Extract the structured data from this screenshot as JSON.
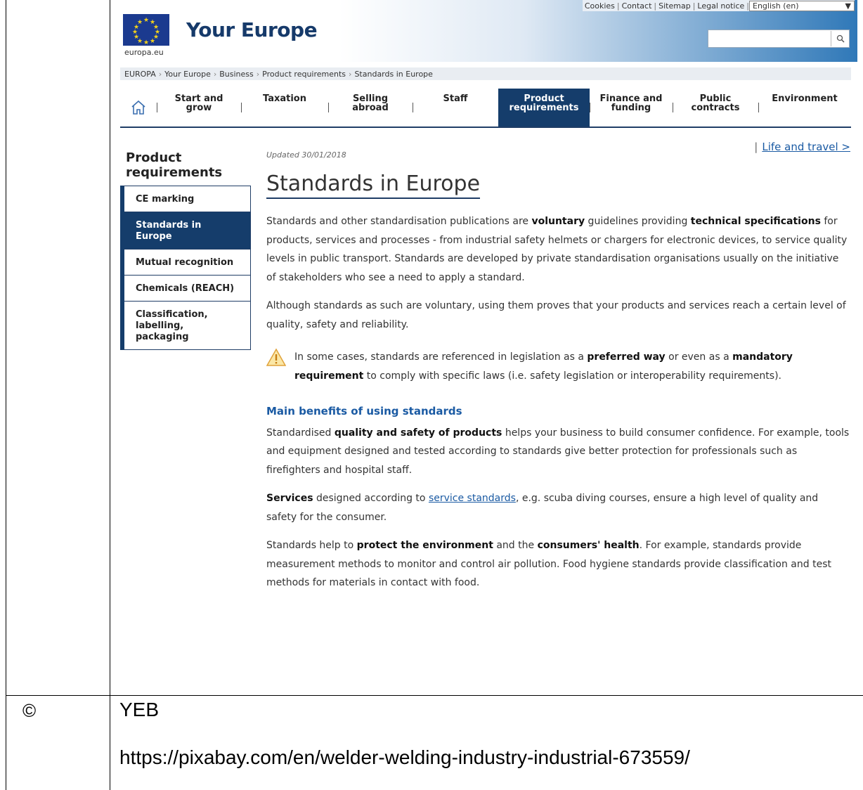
{
  "doc": {
    "copyright_symbol": "©",
    "credit": "YEB",
    "source_url": "https://pixabay.com/en/welder-welding-industry-industrial-673559/"
  },
  "top_links": {
    "cookies": "Cookies",
    "contact": "Contact",
    "sitemap": "Sitemap",
    "legal": "Legal notice",
    "language": "English (en)"
  },
  "header": {
    "europa_label": "europa.eu",
    "site_title": "Your Europe",
    "search_placeholder": ""
  },
  "breadcrumb": [
    "EUROPA",
    "Your Europe",
    "Business",
    "Product requirements",
    "Standards in Europe"
  ],
  "nav": {
    "items": [
      {
        "label": "Start and grow"
      },
      {
        "label": "Taxation"
      },
      {
        "label": "Selling abroad"
      },
      {
        "label": "Staff"
      },
      {
        "label": "Product requirements"
      },
      {
        "label": "Finance and funding"
      },
      {
        "label": "Public contracts"
      },
      {
        "label": "Environment"
      }
    ]
  },
  "sidebar": {
    "title": "Product requirements",
    "items": [
      {
        "label": "CE marking"
      },
      {
        "label": "Standards in Europe"
      },
      {
        "label": "Mutual recognition"
      },
      {
        "label": "Chemicals (REACH)"
      },
      {
        "label": "Classification, labelling, packaging"
      }
    ]
  },
  "life_link": "Life and travel >",
  "updated": "Updated 30/01/2018",
  "page_title": "Standards in Europe",
  "content": {
    "p1": {
      "t1": "Standards and other standardisation publications are ",
      "b1": "voluntary",
      "t2": " guidelines providing ",
      "b2": "technical specifications",
      "t3": " for products, services and processes - from industrial safety helmets or chargers for electronic devices, to service quality levels in public transport. Standards are developed by private standardisation organisations usually on the initiative of stakeholders who see a need to apply a standard."
    },
    "p2": "Although standards as such are voluntary, using them proves that your products and services reach a certain level of quality, safety and reliability.",
    "warn": {
      "t1": "In some cases, standards are referenced in legislation as a ",
      "b1": "preferred way",
      "t2": " or even as a ",
      "b2": "mandatory requirement",
      "t3": " to comply with specific laws (i.e. safety legislation or interoperability requirements)."
    },
    "subheading": "Main benefits of using standards",
    "p3": {
      "t1": "Standardised ",
      "b1": "quality and safety of products",
      "t2": " helps your business to build consumer confidence. For example, tools and equipment designed and tested according to standards give better protection for professionals such as firefighters and hospital staff."
    },
    "p4": {
      "b1": "Services",
      "t1": " designed according to ",
      "link": "service standards",
      "t2": ", e.g. scuba diving courses, ensure a high level of quality and safety for the consumer."
    },
    "p5": {
      "t1": "Standards help to ",
      "b1": "protect the environment",
      "t2": " and the ",
      "b2": "consumers' health",
      "t3": ". For example, standards provide measurement methods to monitor and control air pollution. Food hygiene standards provide classification and test methods for materials in contact with food."
    }
  },
  "colors": {
    "nav_active": "#153d6b",
    "link": "#1a5aa3",
    "eu_blue": "#1b3a8f",
    "eu_star": "#f4d21a"
  }
}
